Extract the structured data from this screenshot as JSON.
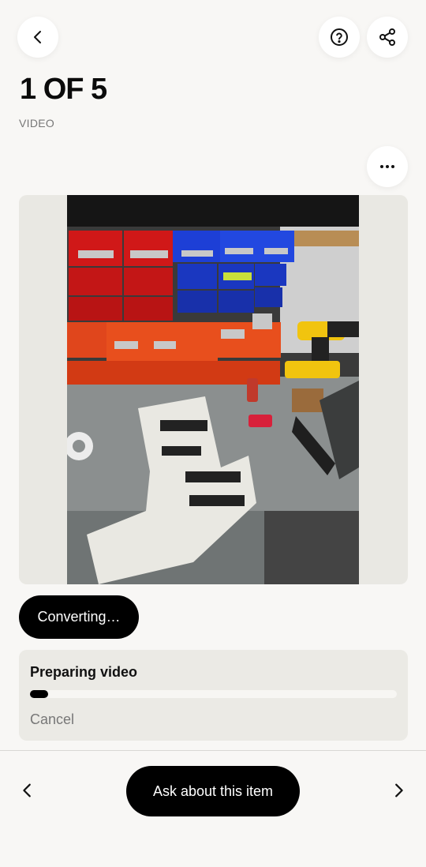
{
  "header": {
    "title": "1 OF 5",
    "subtitle": "VIDEO"
  },
  "icons": {
    "back": "chevron-left-icon",
    "help": "question-circle-icon",
    "share": "share-icon",
    "more": "more-horizontal-icon",
    "prev": "chevron-left-icon",
    "next": "chevron-right-icon"
  },
  "status_pill": "Converting…",
  "progress": {
    "title": "Preparing video",
    "value": 0.05,
    "cancel_label": "Cancel"
  },
  "bottom_bar": {
    "ask_label": "Ask about this item"
  },
  "colors": {
    "background": "#f8f7f5",
    "card": "#ebeae5",
    "accent": "#000000"
  }
}
